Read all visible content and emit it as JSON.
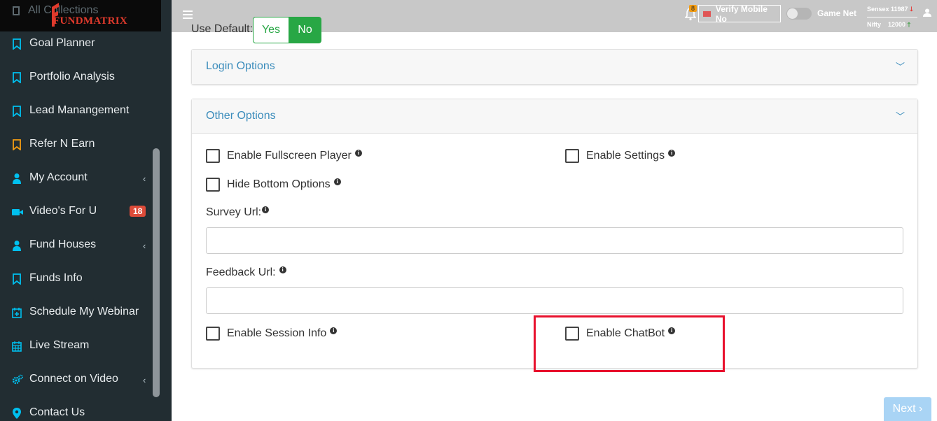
{
  "sidebar": {
    "logo_text": "FUNDMATRIX",
    "ghost_label": "All Collections",
    "items": [
      {
        "label": "Goal Planner",
        "icon": "bookmark-icon",
        "color": "#00c0ef"
      },
      {
        "label": "Portfolio Analysis",
        "icon": "bookmark-icon",
        "color": "#00c0ef"
      },
      {
        "label": "Lead Manangement",
        "icon": "bookmark-icon",
        "color": "#00c0ef"
      },
      {
        "label": "Refer N Earn",
        "icon": "bookmark-icon",
        "color": "#f39c12"
      },
      {
        "label": "My Account",
        "icon": "user-icon",
        "color": "#00c0ef",
        "chevron": "‹"
      },
      {
        "label": "Video's For U",
        "icon": "video-icon",
        "color": "#00c0ef",
        "badge": "18"
      },
      {
        "label": "Fund Houses",
        "icon": "user-icon",
        "color": "#00c0ef",
        "chevron": "‹"
      },
      {
        "label": "Funds Info",
        "icon": "bookmark-icon",
        "color": "#00c0ef"
      },
      {
        "label": "Schedule My Webinar",
        "icon": "calendar-plus-icon",
        "color": "#00c0ef"
      },
      {
        "label": "Live Stream",
        "icon": "calendar-icon",
        "color": "#00c0ef"
      },
      {
        "label": "Connect on Video",
        "icon": "gears-icon",
        "color": "#00c0ef",
        "chevron": "‹"
      },
      {
        "label": "Contact Us",
        "icon": "map-marker-icon",
        "color": "#00c0ef"
      }
    ]
  },
  "topbar": {
    "notification_count": "8",
    "verify_label": "Verify Mobile No",
    "game_net_label": "Game Net",
    "sensex_label": "Sensex 11987",
    "nifty_label": "Nifty",
    "nifty_value": "12000",
    "sensex_arrow": "🡓",
    "nifty_arrow": "🡑"
  },
  "use_default": {
    "label": "Use Default:",
    "yes": "Yes",
    "no": "No",
    "selected": "No"
  },
  "panels": {
    "login": {
      "title": "Login Options"
    },
    "other": {
      "title": "Other Options",
      "enable_fullscreen": "Enable Fullscreen Player",
      "enable_settings": "Enable Settings",
      "hide_bottom": "Hide Bottom Options",
      "survey_label": "Survey Url:",
      "survey_value": "",
      "feedback_label": "Feedback Url:",
      "feedback_value": "",
      "enable_session": "Enable Session Info",
      "enable_chatbot": "Enable ChatBot"
    }
  },
  "next_label": "Next ›",
  "colors": {
    "sidebar_bg": "#222d32",
    "accent": "#3c8dbc",
    "green": "#28a745",
    "highlight": "#e8112d"
  }
}
